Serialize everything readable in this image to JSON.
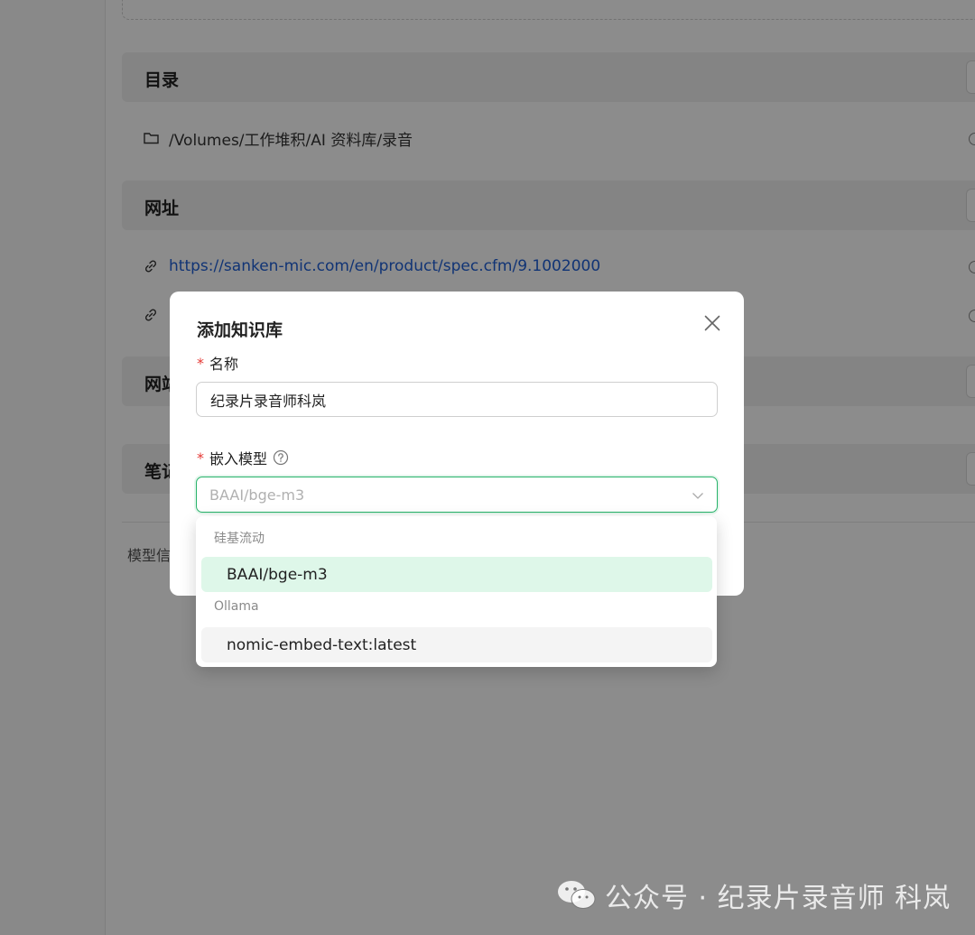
{
  "sections": {
    "directory": {
      "title": "目录",
      "add_label": "+",
      "items": [
        {
          "text": "/Volumes/工作堆积/AI 资料库/录音"
        }
      ]
    },
    "urls": {
      "title": "网址",
      "add_label": "+",
      "items": [
        {
          "text": "https://sanken-mic.com/en/product/spec.cfm/9.1002000"
        }
      ]
    },
    "websites": {
      "title_partial": "网站",
      "add_label": "+"
    },
    "notes": {
      "title_partial": "笔记",
      "add_label": "+"
    },
    "model_info_partial": "模型信"
  },
  "modal": {
    "title": "添加知识库",
    "name_field": {
      "label": "名称",
      "required_mark": "*",
      "value": "纪录片录音师科岚"
    },
    "embed_field": {
      "label": "嵌入模型",
      "required_mark": "*",
      "placeholder": "BAAI/bge-m3"
    }
  },
  "dropdown": {
    "groups": [
      {
        "label": "硅基流动",
        "options": [
          {
            "label": "BAAI/bge-m3",
            "selected": true
          }
        ]
      },
      {
        "label": "Ollama",
        "options": [
          {
            "label": "nomic-embed-text:latest",
            "selected": false
          }
        ]
      }
    ]
  },
  "watermark": {
    "text": "公众号 · 纪录片录音师 科岚"
  },
  "colors": {
    "accent_green": "#27b36a",
    "selected_bg": "#def7e9",
    "link_blue": "#1f5fd6",
    "required_red": "#e53935"
  }
}
